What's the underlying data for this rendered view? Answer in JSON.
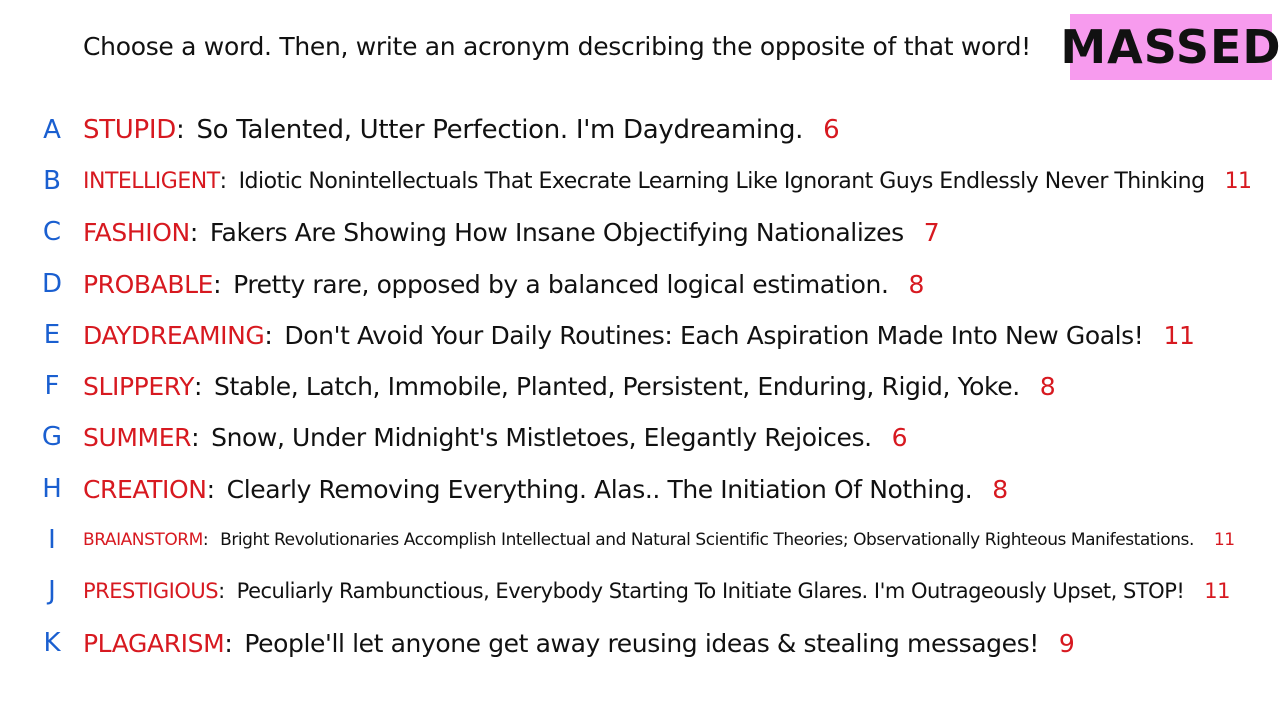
{
  "prompt": "Choose a word. Then, write an acronym describing the opposite of that word!",
  "badge": {
    "label": "MASSED",
    "bg": "#f79bee",
    "text_color": "#111111"
  },
  "colors": {
    "letter": "#1a5fd0",
    "word": "#d71920",
    "count": "#d71920",
    "text": "#111111"
  },
  "rows": [
    {
      "letter": "A",
      "word": "STUPID",
      "acronym": "So Talented, Utter Perfection. I'm Daydreaming.",
      "count": "6"
    },
    {
      "letter": "B",
      "word": "INTELLIGENT",
      "acronym": "Idiotic Nonintellectuals That Execrate Learning Like Ignorant Guys Endlessly Never Thinking",
      "count": "11"
    },
    {
      "letter": "C",
      "word": "FASHION",
      "acronym": "Fakers Are Showing How Insane Objectifying Nationalizes",
      "count": "7"
    },
    {
      "letter": "D",
      "word": "PROBABLE",
      "acronym": "Pretty rare, opposed by a balanced logical estimation.",
      "count": "8"
    },
    {
      "letter": "E",
      "word": "DAYDREAMING",
      "acronym": "Don't Avoid Your Daily Routines: Each Aspiration Made Into New Goals!",
      "count": "11"
    },
    {
      "letter": "F",
      "word": "SLIPPERY",
      "acronym": "Stable, Latch, Immobile, Planted, Persistent, Enduring, Rigid, Yoke.",
      "count": "8"
    },
    {
      "letter": "G",
      "word": "SUMMER",
      "acronym": "Snow, Under Midnight's Mistletoes, Elegantly Rejoices.",
      "count": "6"
    },
    {
      "letter": "H",
      "word": "CREATION",
      "acronym": "Clearly Removing Everything. Alas.. The Initiation Of Nothing.",
      "count": "8"
    },
    {
      "letter": "I",
      "word": "BRAIANSTORM",
      "acronym": "Bright Revolutionaries Accomplish Intellectual and Natural Scientific Theories; Observationally Righteous Manifestations.",
      "count": "11"
    },
    {
      "letter": "J",
      "word": "PRESTIGIOUS",
      "acronym": "Peculiarly Rambunctious, Everybody Starting To Initiate Glares. I'm Outrageously Upset, STOP!",
      "count": "11"
    },
    {
      "letter": "K",
      "word": "PLAGARISM",
      "acronym": "People'll let anyone get away reusing ideas & stealing messages!",
      "count": "9"
    }
  ]
}
